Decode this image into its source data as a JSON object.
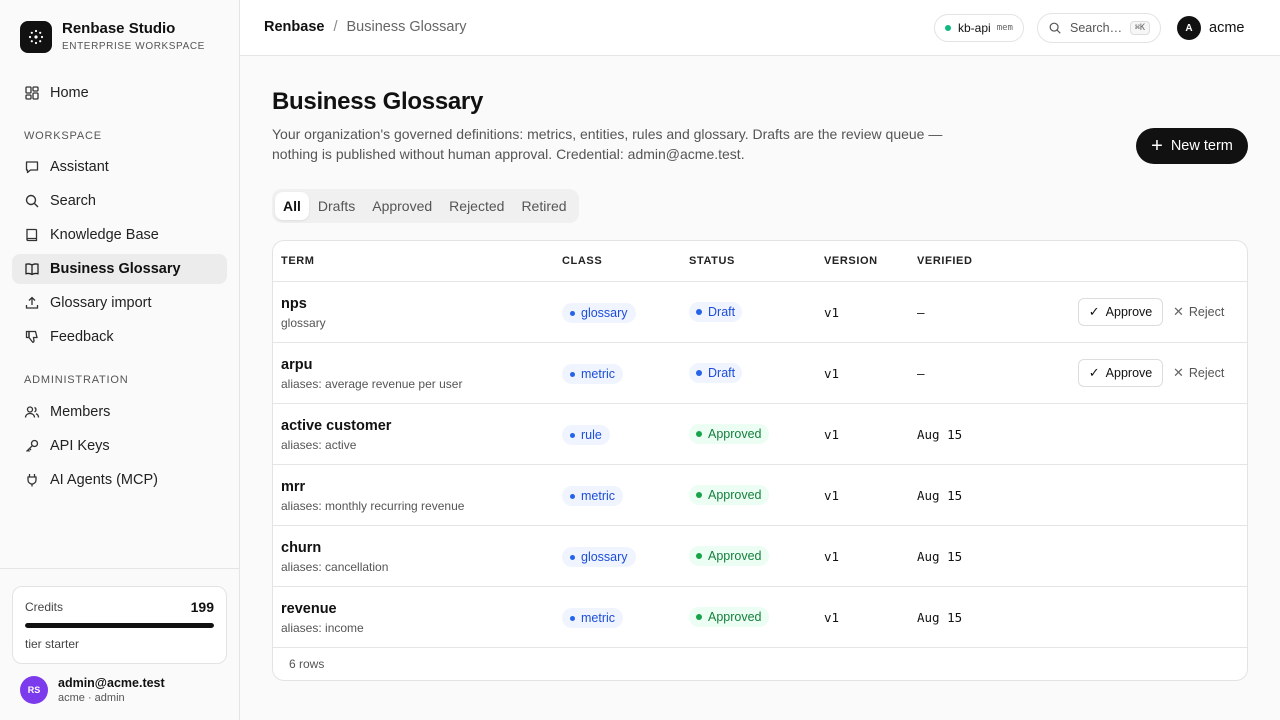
{
  "brand": {
    "name": "Renbase Studio",
    "subtitle": "ENTERPRISE WORKSPACE"
  },
  "nav": {
    "home": "Home",
    "workspace_label": "WORKSPACE",
    "assistant": "Assistant",
    "search": "Search",
    "knowledge_base": "Knowledge Base",
    "business_glossary": "Business Glossary",
    "glossary_import": "Glossary import",
    "feedback": "Feedback",
    "admin_label": "ADMINISTRATION",
    "members": "Members",
    "api_keys": "API Keys",
    "ai_agents": "AI Agents (MCP)"
  },
  "credits": {
    "label": "Credits",
    "value": "199",
    "tier": "tier starter",
    "fill_fraction": 1.0
  },
  "user": {
    "initials": "RS",
    "email": "admin@acme.test",
    "org_role": "acme · admin",
    "avatar_color": "#7c3aed"
  },
  "topbar": {
    "crumb_root": "Renbase",
    "crumb_sep": "/",
    "crumb_current": "Business Glossary",
    "kb_name": "kb-api",
    "kb_tag": "mem",
    "search_placeholder": "Search…",
    "search_shortcut": "⌘K",
    "account_initial": "A",
    "account_name": "acme"
  },
  "page": {
    "title": "Business Glossary",
    "description": "Your organization's governed definitions: metrics, entities, rules and glossary. Drafts are the review queue — nothing is published without human approval. Credential: admin@acme.test.",
    "new_button": "New term",
    "new_button_icon": "+"
  },
  "tabs": [
    "All",
    "Drafts",
    "Approved",
    "Rejected",
    "Retired"
  ],
  "table": {
    "headers": {
      "term": "TERM",
      "class": "CLASS",
      "status": "STATUS",
      "version": "VERSION",
      "verified": "VERIFIED"
    },
    "rows": [
      {
        "term": "nps",
        "sub": "glossary",
        "class": "glossary",
        "status": "Draft",
        "version": "v1",
        "verified": "–",
        "approve": "Approve",
        "reject": "Reject"
      },
      {
        "term": "arpu",
        "sub": "aliases: average revenue per user",
        "class": "metric",
        "status": "Draft",
        "version": "v1",
        "verified": "–",
        "approve": "Approve",
        "reject": "Reject"
      },
      {
        "term": "active customer",
        "sub": "aliases: active",
        "class": "rule",
        "status": "Approved",
        "version": "v1",
        "verified": "Aug 15"
      },
      {
        "term": "mrr",
        "sub": "aliases: monthly recurring revenue",
        "class": "metric",
        "status": "Approved",
        "version": "v1",
        "verified": "Aug 15"
      },
      {
        "term": "churn",
        "sub": "aliases: cancellation",
        "class": "glossary",
        "status": "Approved",
        "version": "v1",
        "verified": "Aug 15"
      },
      {
        "term": "revenue",
        "sub": "aliases: income",
        "class": "metric",
        "status": "Approved",
        "version": "v1",
        "verified": "Aug 15"
      }
    ],
    "footer": "6 rows"
  },
  "colors": {
    "accent": "#111111",
    "draft": "#2563eb",
    "approved": "#16a34a",
    "kb_online": "#10b981"
  }
}
